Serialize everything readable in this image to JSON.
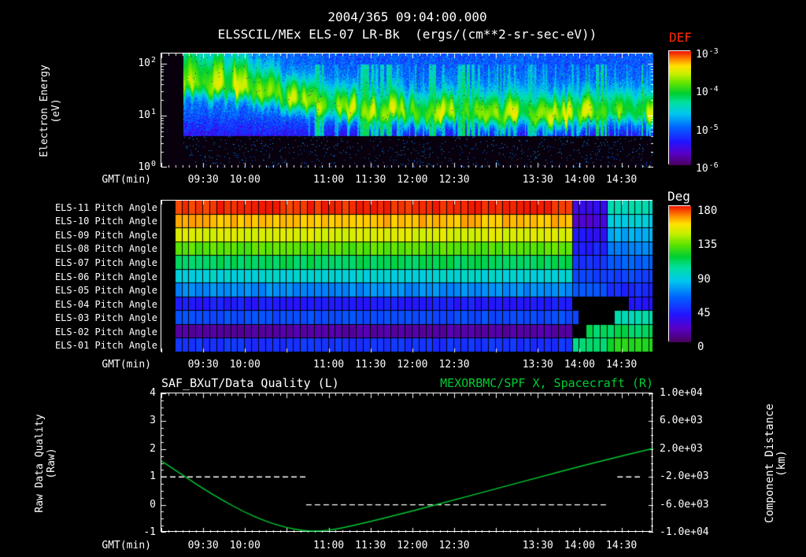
{
  "header": {
    "line1": "2004/365 09:04:00.000",
    "line2": "ELSSCIL/MEx ELS-07 LR-Bk  (ergs/(cm**2-sr-sec-eV))"
  },
  "colors": {
    "background": "#000000",
    "text": "#ffffff",
    "frame": "#ffffff",
    "def_title": "#ff2a00",
    "green_series": "#00cc33",
    "quality_series": "#ffffff",
    "rainbow_stops": [
      [
        0.0,
        "#4b0060"
      ],
      [
        0.1,
        "#5a00c8"
      ],
      [
        0.2,
        "#2414ff"
      ],
      [
        0.33,
        "#0064ff"
      ],
      [
        0.45,
        "#00c8f0"
      ],
      [
        0.55,
        "#00e0a0"
      ],
      [
        0.63,
        "#00d030"
      ],
      [
        0.72,
        "#60e400"
      ],
      [
        0.8,
        "#c8f000"
      ],
      [
        0.87,
        "#ffe400"
      ],
      [
        0.93,
        "#ff8c00"
      ],
      [
        1.0,
        "#f01800"
      ]
    ]
  },
  "time_axis": {
    "label": "GMT(min)",
    "domain": [
      9.0,
      14.88
    ],
    "ticks": [
      {
        "t": 9.5,
        "label": "09:30"
      },
      {
        "t": 10.0,
        "label": "10:00"
      },
      {
        "t": 11.0,
        "label": "11:00"
      },
      {
        "t": 11.5,
        "label": "11:30"
      },
      {
        "t": 12.0,
        "label": "12:00"
      },
      {
        "t": 12.5,
        "label": "12:30"
      },
      {
        "t": 13.5,
        "label": "13:30"
      },
      {
        "t": 14.0,
        "label": "14:00"
      },
      {
        "t": 14.5,
        "label": "14:30"
      }
    ]
  },
  "panel1": {
    "ylabel_line1": "Electron Energy",
    "ylabel_line2": "(eV)",
    "ytick_labels": [
      {
        "log": 2,
        "base": "10",
        "exp": "2"
      },
      {
        "log": 1,
        "base": "10",
        "exp": "1"
      },
      {
        "log": 0,
        "base": "10",
        "exp": "0"
      }
    ],
    "colorbar": {
      "title": "DEF",
      "labels": [
        {
          "base": "10",
          "exp": "-3"
        },
        {
          "base": "10",
          "exp": "-4"
        },
        {
          "base": "10",
          "exp": "-5"
        },
        {
          "base": "10",
          "exp": "-6"
        }
      ]
    }
  },
  "panel2": {
    "row_labels": [
      "ELS-11 Pitch Angle",
      "ELS-10 Pitch Angle",
      "ELS-09 Pitch Angle",
      "ELS-08 Pitch Angle",
      "ELS-07 Pitch Angle",
      "ELS-06 Pitch Angle",
      "ELS-05 Pitch Angle",
      "ELS-04 Pitch Angle",
      "ELS-03 Pitch Angle",
      "ELS-02 Pitch Angle",
      "ELS-01 Pitch Angle"
    ],
    "colorbar": {
      "title": "Deg",
      "labels": [
        "180",
        "135",
        "90",
        "45",
        "0"
      ]
    }
  },
  "panel3": {
    "title_left": "SAF_BXuT/Data Quality (L)",
    "title_right": "MEXORBMC/SPF X, Spacecraft (R)",
    "ylabel_left_line1": "Raw Data Quality",
    "ylabel_left_line2": "(Raw)",
    "ylabel_right_line1": "Component Distance",
    "ylabel_right_line2": "(km)",
    "left_ticks": [
      {
        "v": 4,
        "label": "4"
      },
      {
        "v": 3,
        "label": "3"
      },
      {
        "v": 2,
        "label": "2"
      },
      {
        "v": 1,
        "label": "1"
      },
      {
        "v": 0,
        "label": "0"
      },
      {
        "v": -1,
        "label": "-1"
      }
    ],
    "right_ticks": [
      {
        "v": 10000,
        "label": "1.0e+04"
      },
      {
        "v": 6000,
        "label": "6.0e+03"
      },
      {
        "v": 2000,
        "label": "2.0e+03"
      },
      {
        "v": -2000,
        "label": "-2.0e+03"
      },
      {
        "v": -6000,
        "label": "-6.0e+03"
      },
      {
        "v": -10000,
        "label": "-1.0e+04"
      }
    ]
  },
  "chart_data": [
    {
      "type": "heatmap",
      "name": "electron-energy-spectrogram",
      "title": "ELSSCIL/MEx ELS-07 LR-Bk",
      "units": "ergs/(cm**2-sr-sec-eV)",
      "x_axis": {
        "label": "GMT(min)",
        "start_hour": 9.0,
        "end_hour": 14.88,
        "data_start_hour": 9.26
      },
      "y_axis": {
        "label": "Electron Energy (eV)",
        "scale": "log10",
        "log_range": [
          0,
          2.2
        ],
        "tick_values_ev": [
          1,
          10,
          100
        ]
      },
      "color_axis": {
        "label": "DEF",
        "scale": "log10",
        "min": 1e-06,
        "max": 0.001,
        "tick_values": [
          0.001,
          0.0001,
          1e-05,
          1e-06
        ]
      },
      "band_profile_hour_ev": [
        [
          9.26,
          42
        ],
        [
          9.7,
          38
        ],
        [
          10.2,
          30
        ],
        [
          10.8,
          18
        ],
        [
          11.2,
          13
        ],
        [
          12.0,
          12
        ],
        [
          13.0,
          11
        ],
        [
          13.8,
          10
        ],
        [
          14.3,
          12
        ],
        [
          14.88,
          13
        ]
      ],
      "band_peak_log10": -3.8,
      "background_log10": -5.15,
      "low_energy_cutoff_ev": 4.2,
      "description": "Warm green-yellow flux band descending from ~40 eV at 09:15 to ~10 eV after 11:00 over a blue ~1e-5 background; intermittent vertical flux enhancements after 11:00 clustering near 13:30-14:05; near-black low-signal region with sparse purple speckles below ~4 eV; black data gap before 09:15."
    },
    {
      "type": "heatmap",
      "name": "pitch-angle-panel",
      "bin_minutes": 5,
      "data_start_hour": 9.167,
      "color_axis": {
        "label": "Deg",
        "min": 0,
        "max": 180,
        "tick_values": [
          180,
          135,
          90,
          45,
          0
        ]
      },
      "rows": [
        {
          "label": "ELS-11 Pitch Angle",
          "segments": [
            [
              9.167,
              13.93,
              178
            ],
            [
              13.93,
              14.3,
              30
            ],
            [
              14.3,
              14.88,
              95
            ]
          ]
        },
        {
          "label": "ELS-10 Pitch Angle",
          "segments": [
            [
              9.167,
              13.93,
              162
            ],
            [
              13.93,
              14.3,
              22
            ],
            [
              14.3,
              14.88,
              85
            ]
          ]
        },
        {
          "label": "ELS-09 Pitch Angle",
          "segments": [
            [
              9.167,
              13.93,
              148
            ],
            [
              13.93,
              14.3,
              35
            ],
            [
              14.3,
              14.88,
              75
            ]
          ]
        },
        {
          "label": "ELS-08 Pitch Angle",
          "segments": [
            [
              9.167,
              13.93,
              128
            ],
            [
              13.93,
              14.3,
              40
            ],
            [
              14.3,
              14.88,
              65
            ]
          ]
        },
        {
          "label": "ELS-07 Pitch Angle",
          "segments": [
            [
              9.167,
              13.93,
              108
            ],
            [
              13.93,
              14.3,
              45
            ],
            [
              14.3,
              14.88,
              58
            ]
          ]
        },
        {
          "label": "ELS-06 Pitch Angle",
          "segments": [
            [
              9.167,
              13.93,
              88
            ],
            [
              13.93,
              14.3,
              50
            ],
            [
              14.3,
              14.88,
              50
            ]
          ]
        },
        {
          "label": "ELS-05 Pitch Angle",
          "segments": [
            [
              9.167,
              13.93,
              68
            ],
            [
              13.93,
              14.3,
              55
            ],
            [
              14.3,
              14.88,
              42
            ]
          ]
        },
        {
          "label": "ELS-04 Pitch Angle",
          "segments": [
            [
              9.167,
              13.93,
              38
            ],
            [
              14.55,
              14.88,
              35
            ]
          ]
        },
        {
          "label": "ELS-03 Pitch Angle",
          "segments": [
            [
              9.167,
              14.02,
              52
            ],
            [
              14.38,
              14.88,
              95
            ]
          ]
        },
        {
          "label": "ELS-02 Pitch Angle",
          "segments": [
            [
              9.167,
              13.93,
              12
            ],
            [
              14.1,
              14.88,
              108
            ]
          ]
        },
        {
          "label": "ELS-01 Pitch Angle",
          "segments": [
            [
              9.167,
              13.93,
              45
            ],
            [
              13.93,
              14.3,
              105
            ],
            [
              14.3,
              14.88,
              118
            ]
          ]
        }
      ]
    },
    {
      "type": "line",
      "name": "quality-and-distance",
      "x_axis": {
        "label": "GMT(min)",
        "start_hour": 9.0,
        "end_hour": 14.88
      },
      "left_axis": {
        "label": "Raw Data Quality (Raw)",
        "range": [
          -1,
          4
        ]
      },
      "right_axis": {
        "label": "Component Distance (km)",
        "range": [
          -10000,
          10000
        ]
      },
      "series": [
        {
          "name": "SAF_BXuT/Data Quality (L)",
          "axis": "left",
          "style": "dashed",
          "color": "#ffffff",
          "segments": [
            [
              9.0,
              10.73,
              1
            ],
            [
              10.73,
              14.33,
              0
            ],
            [
              14.45,
              14.72,
              1
            ]
          ]
        },
        {
          "name": "MEXORBMC/SPF X, Spacecraft (R)",
          "axis": "right",
          "style": "solid",
          "color": "#00cc33",
          "points": [
            [
              9.0,
              300
            ],
            [
              9.25,
              -1700
            ],
            [
              9.5,
              -3700
            ],
            [
              9.75,
              -5500
            ],
            [
              10.0,
              -7100
            ],
            [
              10.25,
              -8400
            ],
            [
              10.5,
              -9300
            ],
            [
              10.7,
              -9750
            ],
            [
              10.9,
              -9800
            ],
            [
              11.1,
              -9500
            ],
            [
              11.5,
              -8400
            ],
            [
              12.0,
              -6900
            ],
            [
              12.5,
              -5300
            ],
            [
              13.0,
              -3700
            ],
            [
              13.5,
              -2100
            ],
            [
              14.0,
              -500
            ],
            [
              14.5,
              1000
            ],
            [
              14.88,
              2100
            ]
          ]
        }
      ]
    }
  ]
}
